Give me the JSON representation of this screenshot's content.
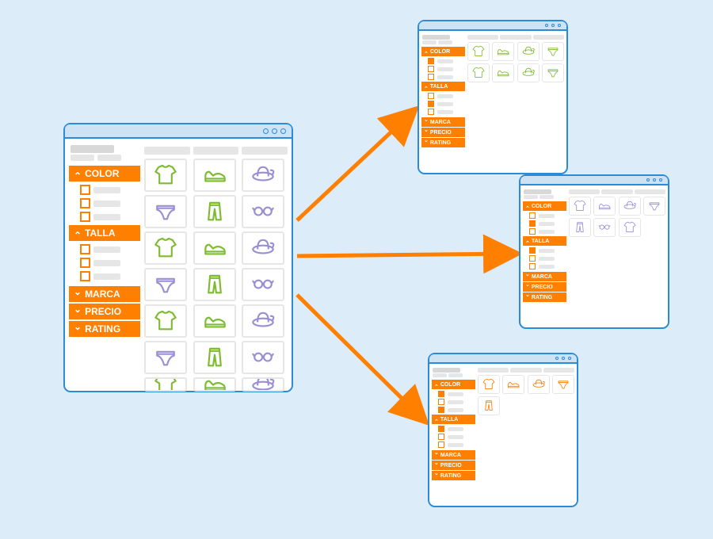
{
  "facets": {
    "color": "COLOR",
    "talla": "TALLA",
    "marca": "MARCA",
    "precio": "PRECIO",
    "rating": "RATING"
  },
  "products": [
    {
      "icon": "tshirt",
      "color": "green"
    },
    {
      "icon": "shoe",
      "color": "green"
    },
    {
      "icon": "hat",
      "color": "purple"
    },
    {
      "icon": "briefs",
      "color": "purple"
    },
    {
      "icon": "pants",
      "color": "green"
    },
    {
      "icon": "glasses",
      "color": "purple"
    }
  ],
  "variants": {
    "v1": {
      "selected": {
        "color": [
          0
        ],
        "talla": [
          1
        ]
      },
      "grid": [
        {
          "icon": "tshirt",
          "color": "green"
        },
        {
          "icon": "shoe",
          "color": "green"
        },
        {
          "icon": "hat",
          "color": "green"
        },
        {
          "icon": "briefs",
          "color": "green"
        },
        {
          "icon": "tshirt",
          "color": "green"
        },
        {
          "icon": "shoe",
          "color": "green"
        },
        {
          "icon": "hat",
          "color": "green"
        },
        {
          "icon": "briefs",
          "color": "green"
        }
      ]
    },
    "v2": {
      "selected": {
        "color": [
          1
        ],
        "talla": [
          0
        ]
      },
      "grid": [
        {
          "icon": "tshirt",
          "color": "purple"
        },
        {
          "icon": "shoe",
          "color": "purple"
        },
        {
          "icon": "hat",
          "color": "purple"
        },
        {
          "icon": "briefs",
          "color": "purple"
        },
        {
          "icon": "pants",
          "color": "purple"
        },
        {
          "icon": "glasses",
          "color": "purple"
        },
        {
          "icon": "tshirt",
          "color": "purple"
        }
      ]
    },
    "v3": {
      "selected": {
        "color": [
          0,
          2
        ],
        "talla": [
          0
        ]
      },
      "grid": [
        {
          "icon": "tshirt",
          "color": "orange"
        },
        {
          "icon": "shoe",
          "color": "orange"
        },
        {
          "icon": "hat",
          "color": "orange"
        },
        {
          "icon": "briefs",
          "color": "orange"
        },
        {
          "icon": "pants",
          "color": "orange"
        }
      ]
    }
  }
}
